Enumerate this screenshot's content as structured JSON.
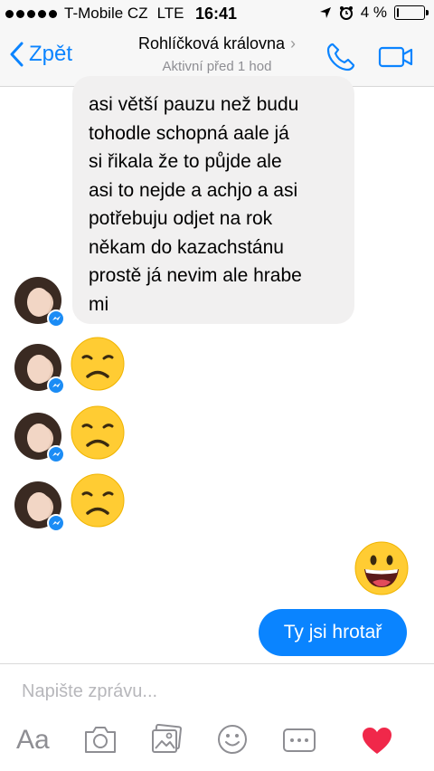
{
  "status": {
    "carrier": "T-Mobile CZ",
    "network": "LTE",
    "time": "16:41",
    "battery_text": "4 %",
    "battery_level": 0.04
  },
  "nav": {
    "back_label": "Zpět",
    "contact_name": "Rohlíčková královna",
    "chevron": "›",
    "subtitle": "Aktivní před 1 hod"
  },
  "messages": {
    "incoming_text": "asi větší pauzu než budu\ntohodle schopná aale já\nsi řikala že to půjde ale\nasi to nejde a achjo a asi\npotřebuju odjet na rok\nněkam do kazachstánu\nprostě já nevim ale hrabe\nmi",
    "incoming_emoji_icon": "disappointed-face-icon",
    "outgoing_emoji_icon": "grinning-face-icon",
    "outgoing_text": "Ty jsi hrotař"
  },
  "composer": {
    "placeholder": "Napište zprávu...",
    "aa_label": "Aa",
    "icons": [
      "camera-icon",
      "gallery-icon",
      "smiley-icon",
      "more-icon",
      "heart-icon"
    ]
  },
  "colors": {
    "accent": "#0a84ff",
    "incoming_bubble": "#f1f0f0",
    "heart": "#f0284a"
  }
}
